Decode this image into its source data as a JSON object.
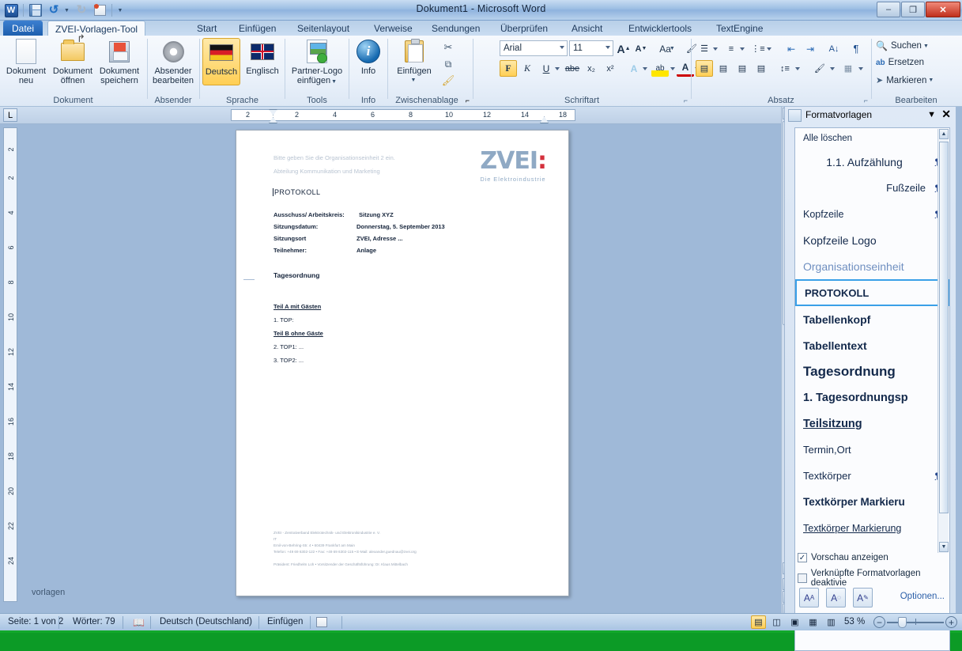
{
  "window": {
    "title": "Dokument1  -  Microsoft Word",
    "minimize": "–",
    "maximize": "❐",
    "close": "✕"
  },
  "quick_access": {
    "word_logo": "W",
    "save": "save-icon",
    "undo": "↺",
    "redo": "↻",
    "print_preview": "print-icon",
    "customize": "▼"
  },
  "tabs": [
    {
      "label": "Datei",
      "state": "file"
    },
    {
      "label": "ZVEI-Vorlagen-Tool",
      "state": "active"
    },
    {
      "label": "Start",
      "state": "normal"
    },
    {
      "label": "Einfügen",
      "state": "normal"
    },
    {
      "label": "Seitenlayout",
      "state": "normal"
    },
    {
      "label": "Verweise",
      "state": "normal"
    },
    {
      "label": "Sendungen",
      "state": "normal"
    },
    {
      "label": "Überprüfen",
      "state": "normal"
    },
    {
      "label": "Ansicht",
      "state": "normal"
    },
    {
      "label": "Entwicklertools",
      "state": "normal"
    },
    {
      "label": "TextEngine",
      "state": "normal"
    }
  ],
  "ribbon": {
    "groups": [
      {
        "name": "Dokument",
        "label": "Dokument",
        "buttons": [
          {
            "line1": "Dokument",
            "line2": "neu",
            "icon": "new-document-icon"
          },
          {
            "line1": "Dokument",
            "line2": "öffnen",
            "icon": "open-folder-icon"
          },
          {
            "line1": "Dokument",
            "line2": "speichern",
            "icon": "floppy-save-icon"
          }
        ]
      },
      {
        "name": "Absender",
        "label": "Absender",
        "buttons": [
          {
            "line1": "Absender",
            "line2": "bearbeiten",
            "icon": "gear-icon"
          }
        ]
      },
      {
        "name": "Sprache",
        "label": "Sprache",
        "buttons": [
          {
            "line1": "Deutsch",
            "line2": "",
            "icon": "german-flag-icon",
            "active": true
          },
          {
            "line1": "Englisch",
            "line2": "",
            "icon": "uk-flag-icon"
          }
        ]
      },
      {
        "name": "Tools",
        "label": "Tools",
        "buttons": [
          {
            "line1": "Partner-Logo",
            "line2": "einfügen",
            "icon": "picture-insert-icon",
            "has_menu": true
          }
        ]
      },
      {
        "name": "Info",
        "label": "Info",
        "buttons": [
          {
            "line1": "Info",
            "line2": "",
            "icon": "info-icon"
          }
        ]
      },
      {
        "name": "Zwischenablage",
        "label": "Zwischenablage",
        "buttons": [
          {
            "line1": "Einfügen",
            "line2": "",
            "icon": "clipboard-paste-icon",
            "has_menu": true
          }
        ],
        "small_buttons": [
          {
            "icon": "scissors-icon",
            "glyph": "✂"
          },
          {
            "icon": "copy-icon",
            "glyph": "⧉"
          },
          {
            "icon": "format-painter-icon",
            "glyph": "🖌"
          }
        ]
      }
    ],
    "font_group": {
      "label": "Schriftart",
      "font_name": "Arial",
      "font_size": "11",
      "grow_font": "A",
      "shrink_font": "A",
      "change_case": "Aa",
      "clear_format": "clear-formatting-icon",
      "bold": "F",
      "italic": "K",
      "underline": "U",
      "strikethrough": "abe",
      "subscript": "x₂",
      "superscript": "x²",
      "text_effects": "A",
      "highlight": "ab",
      "font_color": "A"
    },
    "paragraph_group": {
      "label": "Absatz",
      "bullets": "bullet-list-icon",
      "numbering": "numbered-list-icon",
      "multilevel": "multilevel-list-icon",
      "decrease_indent": "decrease-indent-icon",
      "increase_indent": "increase-indent-icon",
      "sort": "sort-icon",
      "show_marks": "¶",
      "align_left": "align-left-icon",
      "align_center": "align-center-icon",
      "align_right": "align-right-icon",
      "justify": "justify-icon",
      "line_spacing": "line-spacing-icon",
      "shading": "shading-icon",
      "borders": "borders-icon"
    },
    "editing_group": {
      "label": "Bearbeiten",
      "find": "Suchen",
      "replace": "Ersetzen",
      "select": "Markieren"
    }
  },
  "ruler": {
    "tab_stop_glyph": "L",
    "h_ticks": [
      "2",
      "2",
      "4",
      "6",
      "8",
      "10",
      "12",
      "14",
      "18"
    ],
    "v_ticks": [
      "2",
      "2",
      "4",
      "6",
      "8",
      "10",
      "12",
      "14",
      "16",
      "18",
      "20",
      "22",
      "24"
    ]
  },
  "document": {
    "placeholder_line": "Bitte geben Sie die Organisationseinheit 2 ein.",
    "department": "Abteilung Kommunikation und Marketing",
    "heading": "PROTOKOLL",
    "meta": [
      {
        "label": "Ausschuss/ Arbeitskreis:",
        "value": "Sitzung XYZ"
      },
      {
        "label": "Sitzungsdatum:",
        "value": "Donnerstag, 5. September 2013"
      },
      {
        "label": "Sitzungsort",
        "value": "ZVEI, Adresse ..."
      },
      {
        "label": "Teilnehmer:",
        "value": "Anlage"
      }
    ],
    "agenda_heading": "Tagesordnung",
    "agenda": [
      {
        "text": "Teil A mit Gästen",
        "style": "underline"
      },
      {
        "text": "1.   TOP:",
        "style": "item"
      },
      {
        "text": "Teil B ohne Gäste",
        "style": "underline"
      },
      {
        "text": "2.   TOP1: ...",
        "style": "item"
      },
      {
        "text": "3.   TOP2: ...",
        "style": "item"
      }
    ],
    "logo": {
      "mark": "ZVEI",
      "tagline": "Die Elektroindustrie"
    },
    "footer": [
      "ZVEI - Zentralverband Elektrotechnik- und Elektronikindustrie e. V.",
      "IT",
      "Emil-von-Behring-Str. 4 • 60439 Frankfurt am Main",
      "Telefon: +49 69 6302-122 • Fax: +49 69 6302-115 • E-Mail: alexander.guednau@zvei.org",
      "Präsident: Friedhelm Loh • Vorsitzender der Geschäftsführung: Dr. Klaus Mittelbach"
    ],
    "watermark_label": "vorlagen"
  },
  "styles_pane": {
    "title": "Formatvorlagen",
    "dropdown_glyph": "▼",
    "close_glyph": "✕",
    "clear_all": "Alle löschen",
    "items": [
      {
        "label": "1.1.  Aufzählung",
        "mark": "¶a",
        "align": "center",
        "weight": "normal",
        "size": 14,
        "color": "#13294b"
      },
      {
        "label": "Fußzeile",
        "mark": "¶a",
        "align": "right",
        "weight": "normal",
        "size": 13,
        "color": "#13294b"
      },
      {
        "label": "Kopfzeile",
        "mark": "¶a",
        "align": "left",
        "weight": "normal",
        "size": 12.5,
        "color": "#13294b"
      },
      {
        "label": "Kopfzeile Logo",
        "mark": "¶",
        "align": "left",
        "weight": "normal",
        "size": 14,
        "color": "#13294b"
      },
      {
        "label": "Organisationseinheit",
        "mark": "¶",
        "align": "left",
        "weight": "normal",
        "size": 14,
        "color": "#6f8fc0"
      },
      {
        "label": "PROTOKOLL",
        "mark": "¶",
        "align": "left",
        "weight": "bold",
        "size": 13,
        "color": "#13294b",
        "selected": true
      },
      {
        "label": "Tabellenkopf",
        "mark": "¶",
        "align": "left",
        "weight": "bold",
        "size": 14,
        "color": "#13294b"
      },
      {
        "label": "Tabellentext",
        "mark": "¶",
        "align": "left",
        "weight": "bold",
        "size": 14,
        "color": "#13294b"
      },
      {
        "label": "Tagesordnung",
        "mark": "¶",
        "align": "left",
        "weight": "bold",
        "size": 17,
        "color": "#13294b"
      },
      {
        "label": "1.  Tagesordnungsp",
        "mark": "¶",
        "align": "left",
        "weight": "bold",
        "size": 14.5,
        "color": "#13294b"
      },
      {
        "label": "Teilsitzung",
        "mark": "¶",
        "align": "left",
        "weight": "bold",
        "size": 14.5,
        "color": "#13294b",
        "underline": true
      },
      {
        "label": "Termin,Ort",
        "mark": "¶",
        "align": "left",
        "weight": "normal",
        "size": 13,
        "color": "#13294b"
      },
      {
        "label": "Textkörper",
        "mark": "¶a",
        "align": "left",
        "weight": "normal",
        "size": 13,
        "color": "#13294b"
      },
      {
        "label": "Textkörper Markieru",
        "mark": "a",
        "align": "left",
        "weight": "bold",
        "size": 13.5,
        "color": "#13294b"
      },
      {
        "label": "Textkörper Markierung",
        "mark": "a",
        "align": "left",
        "weight": "normal",
        "size": 12.5,
        "color": "#13294b",
        "underline": true
      }
    ],
    "preview_checkbox": {
      "label": "Vorschau anzeigen",
      "checked": true,
      "glyph": "✓"
    },
    "disable_linked_checkbox": {
      "label": "Verknüpfte Formatvorlagen deaktivie",
      "checked": false,
      "glyph": ""
    },
    "footer_buttons": [
      {
        "name": "new-style-button",
        "glyph": "A"
      },
      {
        "name": "style-inspector-button",
        "glyph": "A"
      },
      {
        "name": "manage-styles-button",
        "glyph": "A"
      }
    ],
    "options_link": "Optionen..."
  },
  "status_bar": {
    "page": "Seite: 1 von 2",
    "words": "Wörter: 79",
    "proofing_icon": "proofing-errors-icon",
    "language": "Deutsch (Deutschland)",
    "insert_mode": "Einfügen",
    "macro_icon": "macro-record-icon",
    "view_buttons": [
      {
        "name": "print-layout-view",
        "glyph": "▤",
        "active": true
      },
      {
        "name": "fullscreen-reading-view",
        "glyph": "◫",
        "active": false
      },
      {
        "name": "web-layout-view",
        "glyph": "▣",
        "active": false
      },
      {
        "name": "outline-view",
        "glyph": "▦",
        "active": false
      },
      {
        "name": "draft-view",
        "glyph": "▥",
        "active": false
      }
    ],
    "zoom_level": "53 %",
    "zoom_out": "−",
    "zoom_in": "+"
  }
}
